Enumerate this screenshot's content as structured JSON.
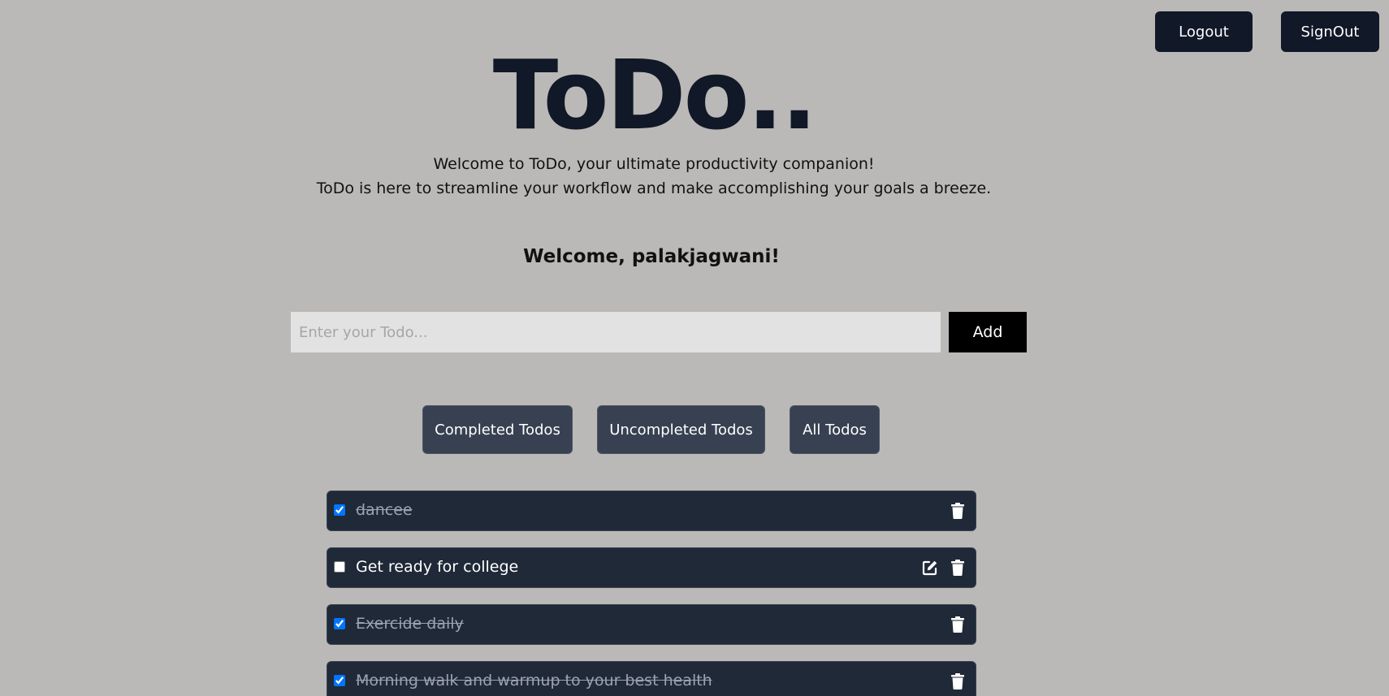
{
  "header": {
    "logout_label": "Logout",
    "signout_label": "SignOut"
  },
  "hero": {
    "title": "ToDo..",
    "intro_line1": "Welcome to ToDo, your ultimate productivity companion!",
    "intro_line2": "ToDo is here to streamline your workflow and make accomplishing your goals a breeze."
  },
  "user": {
    "welcome": "Welcome, palakjagwani!"
  },
  "new_todo": {
    "value": "",
    "placeholder": "Enter your Todo...",
    "add_label": "Add"
  },
  "filters": {
    "completed_label": "Completed Todos",
    "uncompleted_label": "Uncompleted Todos",
    "all_label": "All Todos"
  },
  "todos": [
    {
      "text": "dancee",
      "completed": true
    },
    {
      "text": "Get ready for college",
      "completed": false
    },
    {
      "text": "Exercide daily",
      "completed": true
    },
    {
      "text": "Morning walk and warmup to your best health",
      "completed": true
    }
  ],
  "icons": {
    "edit": "edit-icon",
    "delete": "trash-icon"
  },
  "colors": {
    "background": "#bab9b7",
    "dark_button": "#111827",
    "filter_button": "#374151",
    "todo_row": "#1f2937",
    "add_button": "#000000"
  }
}
